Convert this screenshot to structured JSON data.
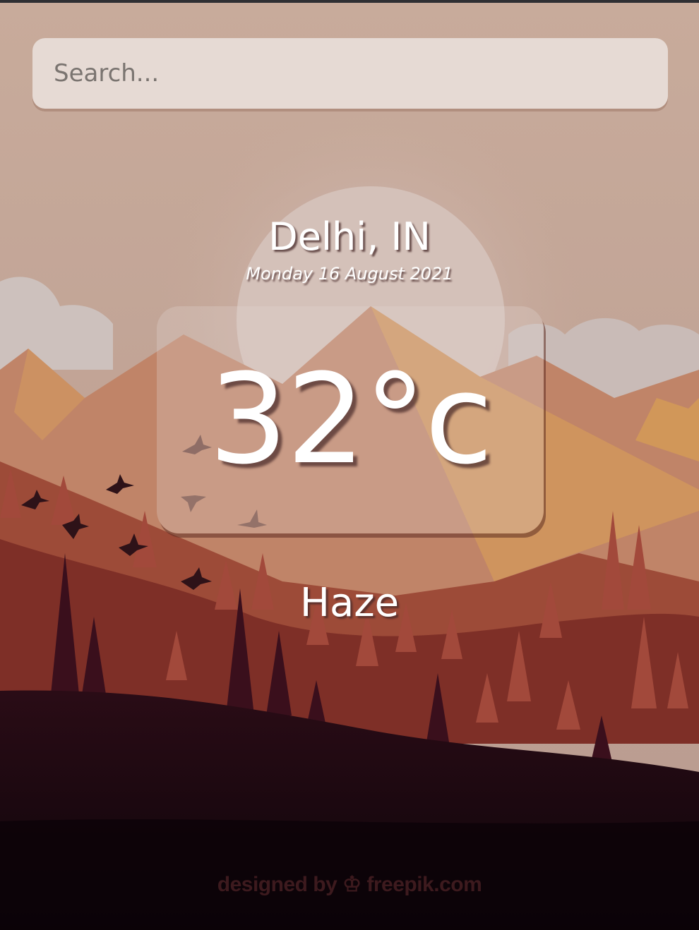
{
  "search": {
    "placeholder": "Search...",
    "value": ""
  },
  "location": "Delhi, IN",
  "date": "Monday 16 August 2021",
  "temperature": "32°c",
  "condition": "Haze",
  "credit": "designed by ♔ freepik.com",
  "colors": {
    "sky_top": "#c8ab9b",
    "sun": "#d8c6c0",
    "mountain_peak": "#c98a6e",
    "mountain_dark": "#8e3f31",
    "forest": "#6e2521",
    "ground": "#1a0711"
  }
}
